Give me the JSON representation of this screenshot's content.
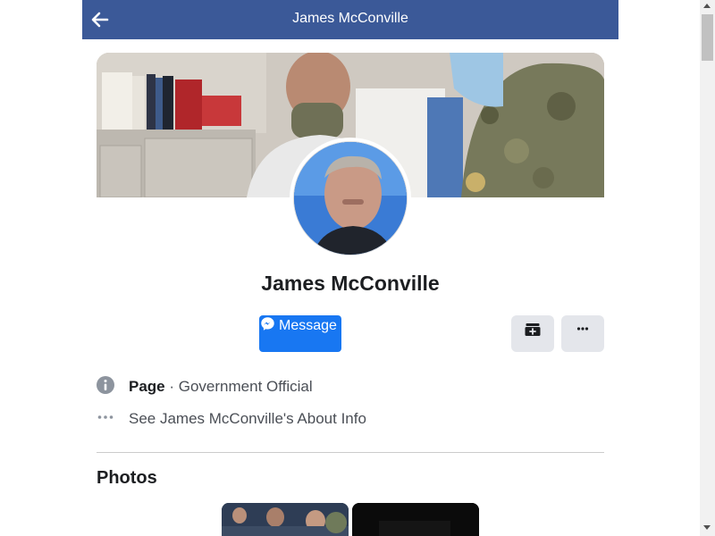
{
  "header": {
    "title": "James McConville",
    "back_icon": "arrow-left-icon",
    "bg_color": "#3b5998"
  },
  "profile": {
    "name": "James McConville"
  },
  "actions": {
    "message_label": "Message",
    "message_icon": "messenger-icon",
    "save_icon": "save-icon",
    "more_icon": "more-icon",
    "accent_color": "#1877f2"
  },
  "info": {
    "category_prefix": "Page",
    "category_separator": " · ",
    "category": "Government Official",
    "about_link": "See James McConville's About Info"
  },
  "photos": {
    "heading": "Photos"
  }
}
